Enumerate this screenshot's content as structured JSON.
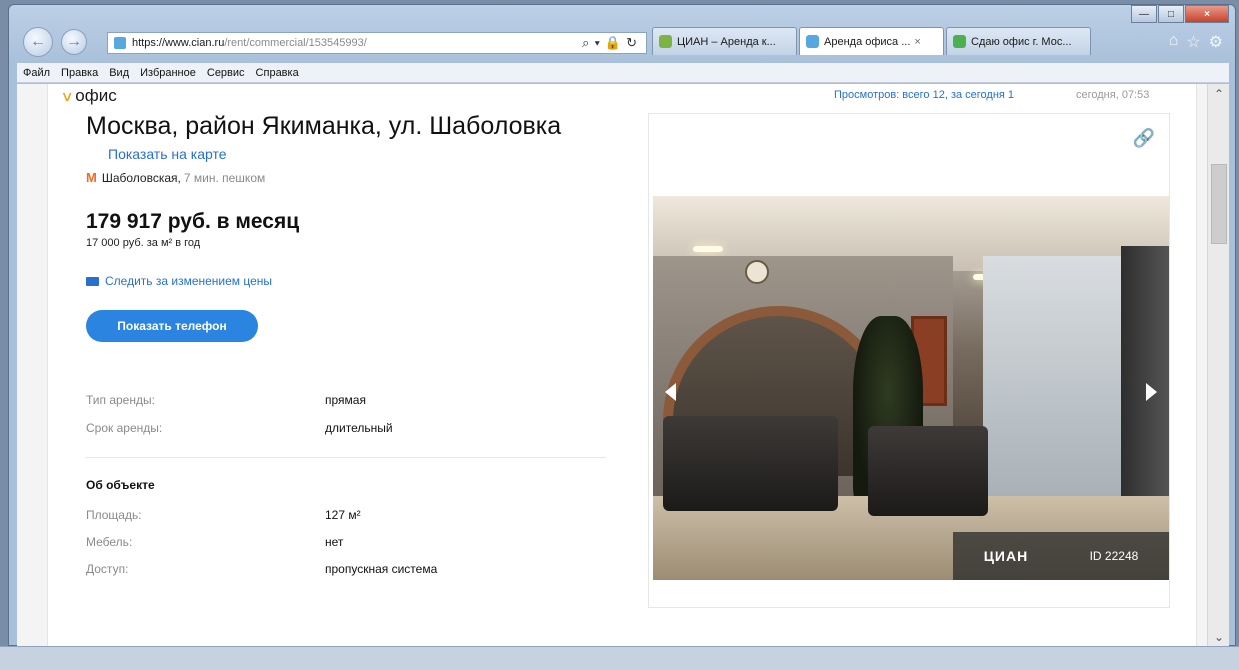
{
  "browser": {
    "url_host": "https://www.cian.ru",
    "url_path": "/rent/commercial/153545993/",
    "tabs": [
      {
        "label": "ЦИАН – Аренда к...",
        "color": "#7cb342",
        "active": false
      },
      {
        "label": "Аренда офиса ...",
        "color": "#58a8e0",
        "active": true,
        "close": "×"
      },
      {
        "label": "Сдаю офис г. Мос...",
        "color": "#4caf50",
        "active": false
      }
    ],
    "menu": [
      "Файл",
      "Правка",
      "Вид",
      "Избранное",
      "Сервис",
      "Справка"
    ]
  },
  "listing": {
    "type": "офис",
    "address": "Москва, район Якиманка, ул. Шаболовка",
    "map_link": "Показать на карте",
    "metro_station": "Шаболовская,",
    "metro_distance": "7 мин. пешком",
    "price": "179 917 руб. в месяц",
    "price_per_m2": "17 000 руб. за м² в год",
    "follow_price": "Следить за изменением цены",
    "show_phone": "Показать телефон",
    "rent_terms": [
      {
        "label": "Тип аренды:",
        "value": "прямая"
      },
      {
        "label": "Срок аренды:",
        "value": "длительный"
      }
    ],
    "object_section_title": "Об объекте",
    "object_props": [
      {
        "label": "Площадь:",
        "value": "127 м²"
      },
      {
        "label": "Мебель:",
        "value": "нет"
      },
      {
        "label": "Доступ:",
        "value": "пропускная система"
      }
    ],
    "views": "Просмотров: всего 12, за сегодня 1",
    "updated": "сегодня, 07:53",
    "photo_brand": "ЦИАН",
    "photo_id": "ID 22248"
  },
  "colors": {
    "accent": "#2b84e0",
    "link": "#2570d6",
    "metro": "#f26b1d",
    "type_chevron": "#f0a21a"
  }
}
